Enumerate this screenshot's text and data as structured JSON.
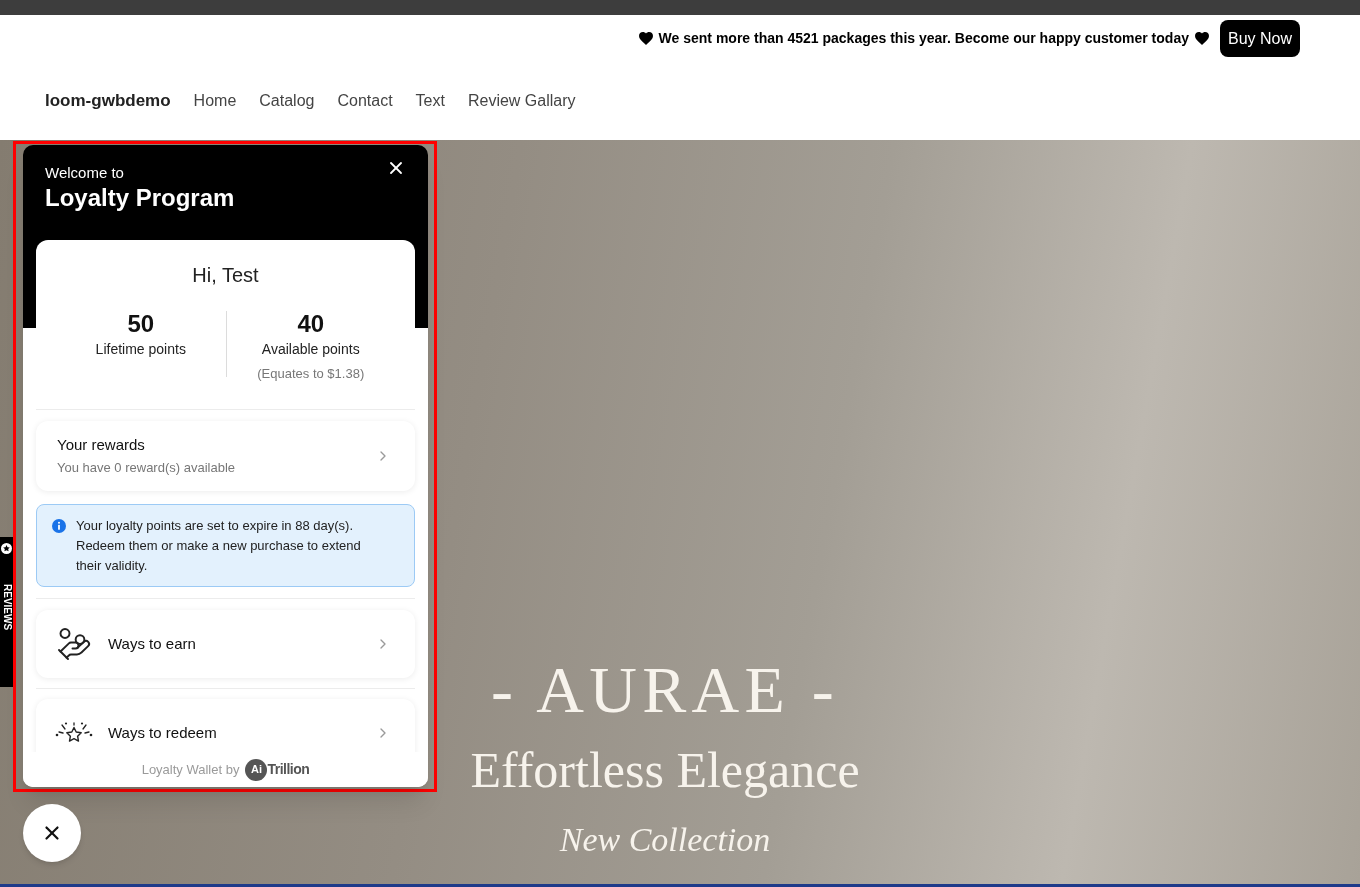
{
  "announcement": {
    "message": "We sent more than 4521 packages this year. Become our happy customer today",
    "button": "Buy Now"
  },
  "nav": {
    "brand": "loom-gwbdemo",
    "links": [
      {
        "label": "Home"
      },
      {
        "label": "Catalog"
      },
      {
        "label": "Contact"
      },
      {
        "label": "Text"
      },
      {
        "label": "Review Gallary"
      }
    ]
  },
  "reviews_tab": {
    "label": "REVIEWS"
  },
  "hero": {
    "title": "- AURAE -",
    "subtitle": "Effortless Elegance",
    "tagline": "New Collection"
  },
  "loyalty_panel": {
    "welcome": "Welcome to",
    "title": "Loyalty Program",
    "greeting": "Hi, Test",
    "stats": [
      {
        "value": "50",
        "label": "Lifetime points"
      },
      {
        "value": "40",
        "label": "Available points",
        "note": "(Equates to $1.38)"
      }
    ],
    "rewards": {
      "title": "Your rewards",
      "subtitle": "You have 0 reward(s) available"
    },
    "notice": "Your loyalty points are set to expire in 88 day(s). Redeem them or make a new purchase to extend their validity.",
    "menu": [
      {
        "kind": "earn",
        "label": "Ways to earn"
      },
      {
        "kind": "redeem",
        "label": "Ways to redeem"
      }
    ],
    "footer": {
      "text": "Loyalty Wallet by",
      "logo_mark": "Ai",
      "logo_name": "Trillion"
    }
  }
}
